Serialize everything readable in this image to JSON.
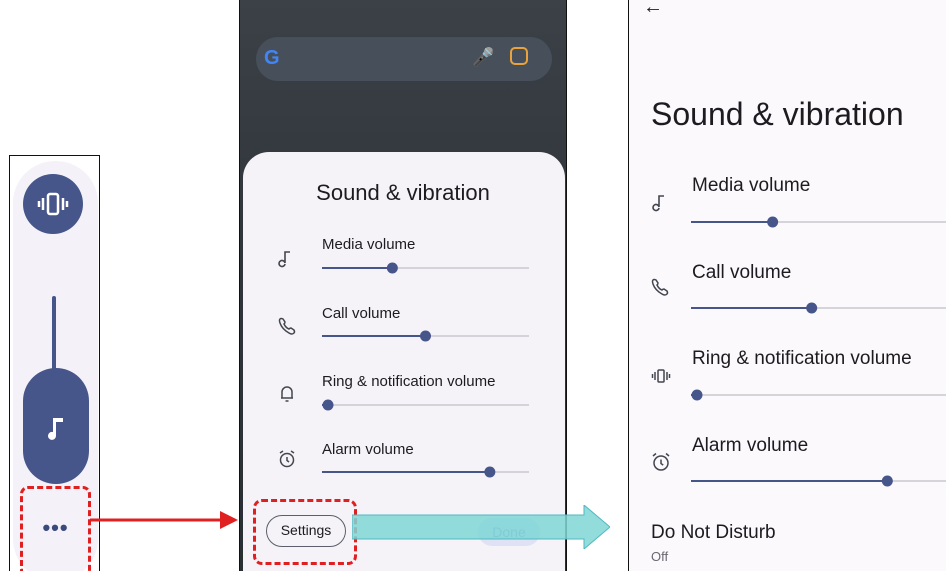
{
  "panel2": {
    "title": "Sound & vibration",
    "rows": [
      {
        "label": "Media volume",
        "icon": "music-note-icon",
        "level": 0.33
      },
      {
        "label": "Call volume",
        "icon": "phone-icon",
        "level": 0.5
      },
      {
        "label": "Ring & notification volume",
        "icon": "bell-icon",
        "level": 0.0
      },
      {
        "label": "Alarm volume",
        "icon": "alarm-clock-icon",
        "level": 0.83
      }
    ],
    "settings_label": "Settings",
    "done_label": "Done"
  },
  "panel3": {
    "title": "Sound & vibration",
    "rows": [
      {
        "label": "Media volume",
        "icon": "music-note-icon",
        "level": 0.31
      },
      {
        "label": "Call volume",
        "icon": "phone-icon",
        "level": 0.47
      },
      {
        "label": "Ring & notification volume",
        "icon": "vibrate-icon",
        "level": 0.0
      },
      {
        "label": "Alarm volume",
        "icon": "alarm-clock-icon",
        "level": 0.78
      }
    ],
    "dnd_title": "Do Not Disturb",
    "dnd_status": "Off"
  },
  "panel1": {
    "mode_icon": "vibrate-icon",
    "slider_icon": "music-note-icon",
    "more_label": "•••"
  },
  "colors": {
    "accent": "#46558a",
    "highlight": "#e02020",
    "arrow_cyan": "#7fd6d6"
  }
}
